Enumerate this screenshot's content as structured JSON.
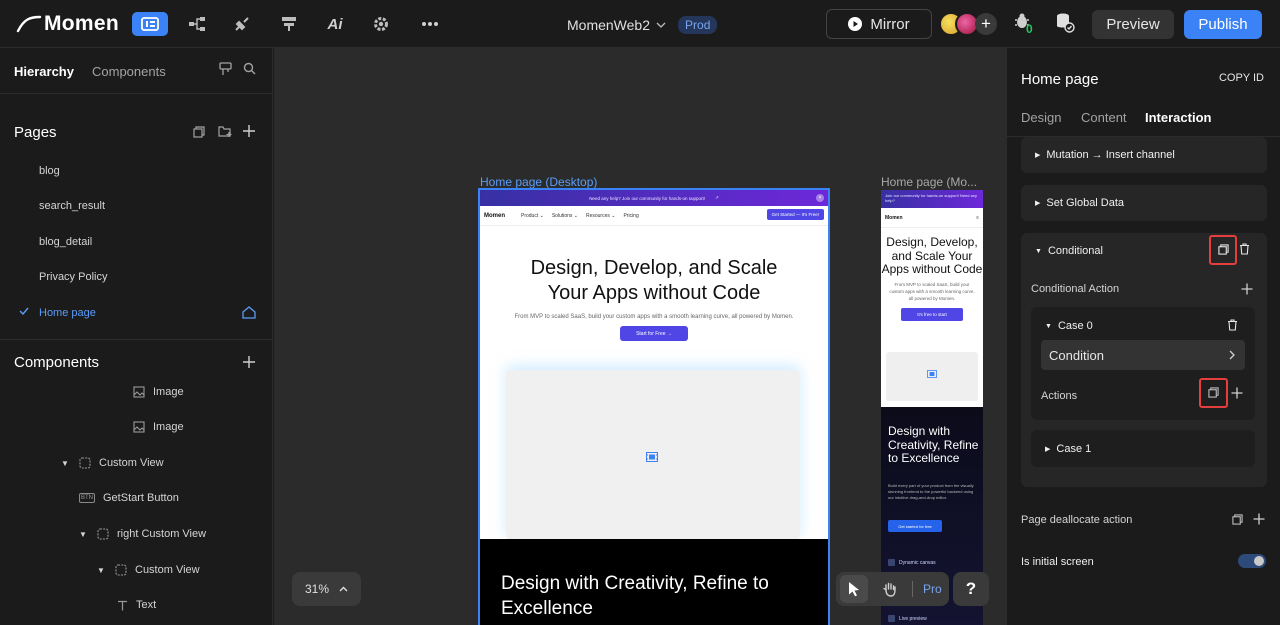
{
  "topbar": {
    "logo": "Momen",
    "ai_label": "Ai",
    "project_name": "MomenWeb2",
    "env_badge": "Prod",
    "mirror_label": "Mirror",
    "bug_count": "0",
    "preview_label": "Preview",
    "publish_label": "Publish",
    "tools": [
      "layout-icon",
      "flow-icon",
      "plugin-icon",
      "data-icon",
      "ai-icon",
      "settings-icon",
      "more-icon"
    ]
  },
  "left": {
    "tabs": [
      "Hierarchy",
      "Components"
    ],
    "pages_title": "Pages",
    "pages": [
      "blog",
      "search_result",
      "blog_detail",
      "Privacy Policy",
      "Home page"
    ],
    "selected_page": "Home page",
    "components_title": "Components",
    "tree": [
      {
        "label": "Image",
        "type": "image"
      },
      {
        "label": "Image",
        "type": "image"
      },
      {
        "label": "Custom View",
        "type": "view"
      },
      {
        "label": "GetStart Button",
        "type": "button"
      },
      {
        "label": "right Custom View",
        "type": "view"
      },
      {
        "label": "Custom View",
        "type": "view"
      },
      {
        "label": "Text",
        "type": "text"
      }
    ],
    "btn_tag": "BTN"
  },
  "canvas": {
    "desktop_label": "Home page (Desktop)",
    "mobile_label": "Home page (Mo...",
    "desktop": {
      "banner": "Need any help? Join our community for hands-on support!",
      "brand": "Momen",
      "nav": [
        "Product ⌄",
        "Solutions ⌄",
        "Resources ⌄",
        "Pricing"
      ],
      "cta": "Get Started — It's Free!",
      "hero_title": "Design, Develop, and Scale Your Apps without Code",
      "hero_sub": "From MVP to scaled SaaS, build your custom apps with a smooth learning curve, all powered by Momen.",
      "hero_btn": "Start for Free →",
      "dark_title": "Design with Creativity, Refine to Excellence"
    },
    "mobile": {
      "banner": "Join our community for hands-on support! Need any help?",
      "brand": "Momen",
      "hero_title": "Design, Develop, and Scale Your Apps without Code",
      "hero_sub": "From MVP to scaled SaaS, build your custom apps with a smooth learning curve, all powered by Momen.",
      "hero_btn": "It's free to start",
      "dark_title": "Design with Creativity, Refine to Excellence",
      "dark_sub": "Build every part of your product from the visually stunning frontend to the powerful backend using our intuitive drag-and-drop editor.",
      "dark_btn": "Get started for free",
      "features": [
        "Dynamic canvas",
        "Live preview"
      ]
    },
    "zoom": "31%",
    "pro_label": "Pro",
    "help_label": "?"
  },
  "right": {
    "title": "Home page",
    "copy_id": "COPY ID",
    "tabs": [
      "Design",
      "Content",
      "Interaction"
    ],
    "active_tab": "Interaction",
    "actions": [
      "Mutation → Insert channel",
      "Set Global Data",
      "Conditional"
    ],
    "conditional_action_label": "Conditional Action",
    "case0": "Case 0",
    "condition_label": "Condition",
    "actions_label": "Actions",
    "case1": "Case 1",
    "page_dealloc": "Page deallocate action",
    "initial_screen": "Is initial screen",
    "initial_screen_on": true
  },
  "colors": {
    "accent": "#3b82f6",
    "highlight": "#e53e3e",
    "bg": "#1b1b1b",
    "canvas": "#2b2b2b"
  }
}
